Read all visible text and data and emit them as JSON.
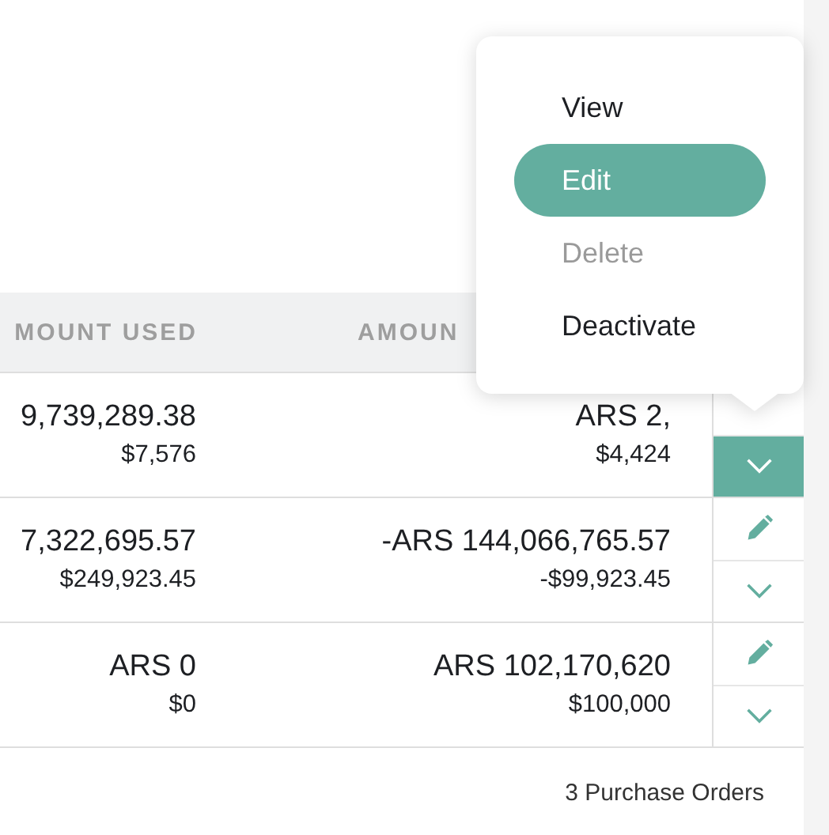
{
  "table": {
    "columns": [
      "MOUNT USED",
      "AMOUN"
    ],
    "rows": [
      {
        "cells": [
          {
            "main": "9,739,289.38",
            "usd": "$7,576"
          },
          {
            "main": "ARS 2,",
            "usd": "$4,424"
          }
        ],
        "edit": false,
        "expanded": true
      },
      {
        "cells": [
          {
            "main": "7,322,695.57",
            "usd": "$249,923.45"
          },
          {
            "main": "-ARS 144,066,765.57",
            "usd": "-$99,923.45"
          }
        ],
        "edit": true,
        "expanded": false
      },
      {
        "cells": [
          {
            "main": "ARS 0",
            "usd": "$0"
          },
          {
            "main": "ARS 102,170,620",
            "usd": "$100,000"
          }
        ],
        "edit": true,
        "expanded": false
      }
    ]
  },
  "footer": "3 Purchase Orders",
  "menu": {
    "items": [
      {
        "label": "View",
        "selected": false,
        "disabled": false
      },
      {
        "label": "Edit",
        "selected": true,
        "disabled": false
      },
      {
        "label": "Delete",
        "selected": false,
        "disabled": true
      },
      {
        "label": "Deactivate",
        "selected": false,
        "disabled": false
      }
    ]
  }
}
